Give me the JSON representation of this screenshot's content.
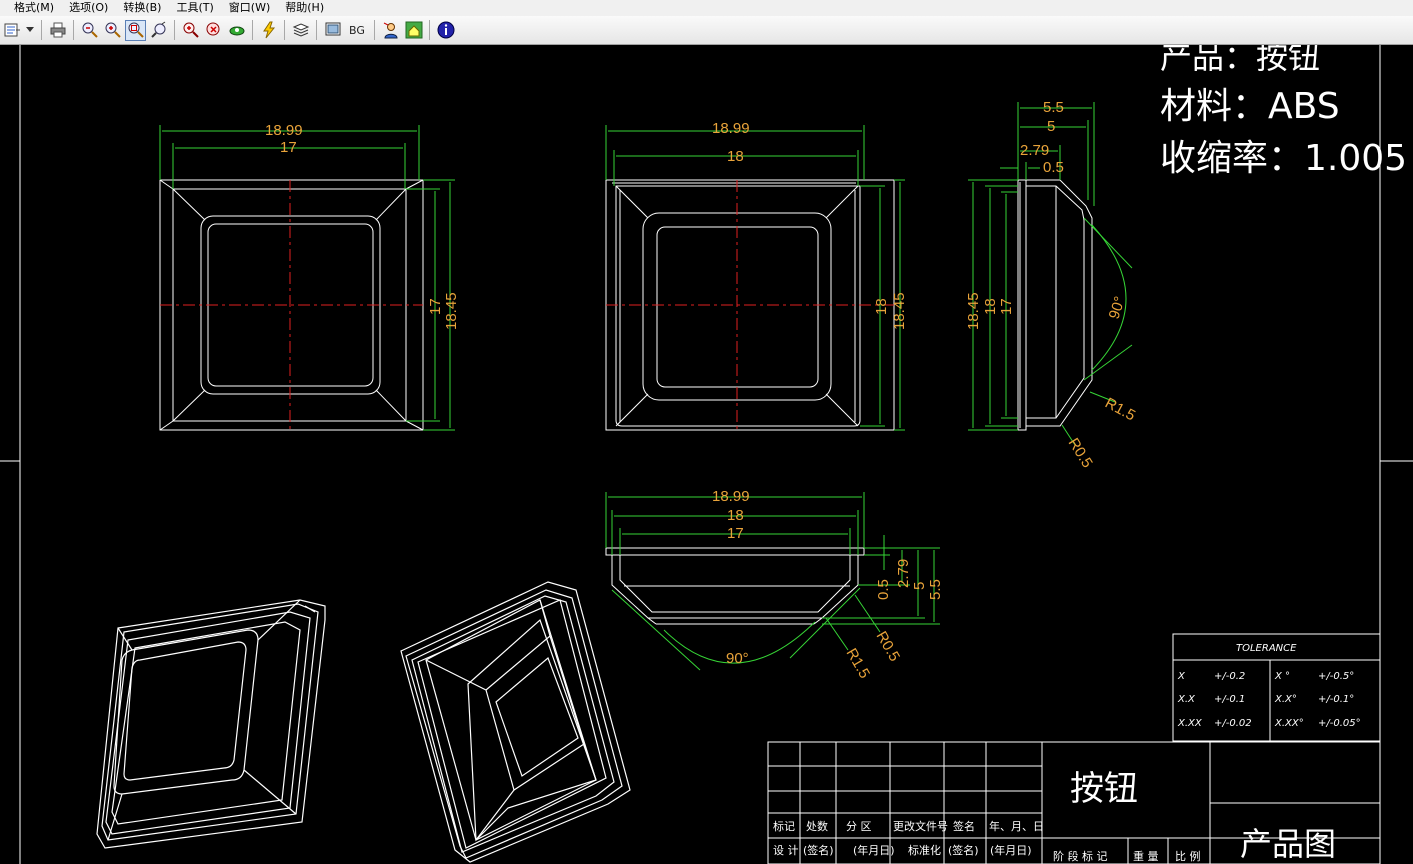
{
  "menu": {
    "items": [
      "格式(M)",
      "选项(O)",
      "转换(B)",
      "工具(T)",
      "窗口(W)",
      "帮助(H)"
    ]
  },
  "toolbar": {
    "buttons": [
      "print-icon",
      "zoom-out-icon",
      "zoom-in-icon",
      "zoom-window-icon",
      "zoom-realtime-icon",
      "pan-zoom-icon",
      "zoom-previous-icon",
      "3d-orbit-icon",
      "lightning-icon",
      "layers-icon",
      "display-icon",
      "background-toggle",
      "user-icon",
      "home-icon",
      "info-icon"
    ],
    "bg_label": "BG"
  },
  "colors": {
    "background": "#000000",
    "lines": "#ffffff",
    "dimension_lines": "#36d436",
    "dimension_text": "#e8a33a",
    "center_lines": "#e02020"
  },
  "notes": {
    "product": "产品：按钮",
    "material": "材料：ABS",
    "shrinkage": "收缩率：1.005"
  },
  "views": {
    "top": {
      "width_overall": "18.99",
      "width_inner": "17",
      "height_inner": "17",
      "height_overall": "18.45"
    },
    "front": {
      "width_overall": "18.99",
      "width_inner": "18",
      "height_inner": "18",
      "height_overall": "18.45"
    },
    "side": {
      "d1": "5.5",
      "d2": "5",
      "d3": "2.79",
      "d4": "0.5",
      "h1": "18.45",
      "h2": "18",
      "h3": "17",
      "angle": "90°",
      "r_large": "R1.5",
      "r_small": "R0.5"
    },
    "section": {
      "w1": "18.99",
      "w2": "18",
      "w3": "17",
      "v1": "0.5",
      "v2": "2.79",
      "v3": "5",
      "v4": "5.5",
      "angle": "90°",
      "r_large": "R1.5",
      "r_small": "R0.5"
    }
  },
  "tolerance": {
    "title": "TOLERANCE",
    "rows": [
      {
        "k1": "X",
        "v1": "+/-0.2",
        "k2": "X °",
        "v2": "+/-0.5°"
      },
      {
        "k1": "X.X",
        "v1": "+/-0.1",
        "k2": "X.X°",
        "v2": "+/-0.1°"
      },
      {
        "k1": "X.XX",
        "v1": "+/-0.02",
        "k2": "X.XX°",
        "v2": "+/-0.05°"
      }
    ]
  },
  "title_block": {
    "part_name": "按钮",
    "drawing_type": "产品图",
    "row1": [
      "标记",
      "处数",
      "分 区",
      "更改文件号",
      "签名",
      "年、月、日"
    ],
    "row2": [
      "设 计",
      "(签名)",
      "(年月日)",
      "标准化",
      "(签名)",
      "(年月日)"
    ],
    "row2_right": [
      "阶 段 标 记",
      "重 量",
      "比 例"
    ]
  }
}
